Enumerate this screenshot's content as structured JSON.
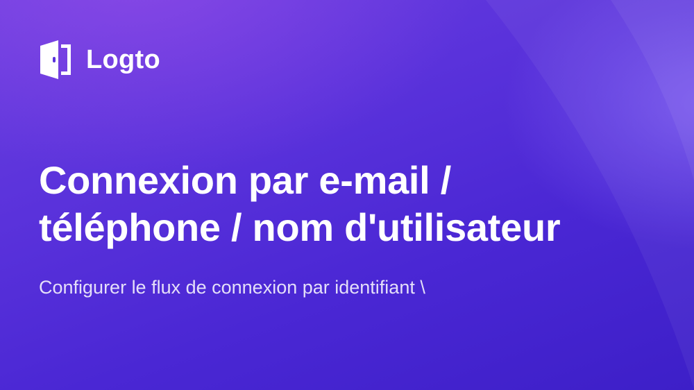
{
  "brand": {
    "name": "Logto",
    "icon": "door-icon"
  },
  "headline": {
    "line1": "Connexion par e-mail /",
    "line2": "téléphone / nom d'utilisateur"
  },
  "subtitle": "Configurer le flux de connexion par identifiant \\",
  "colors": {
    "background_start": "#6a3fe0",
    "background_end": "#3d1fc8",
    "text": "#ffffff"
  }
}
